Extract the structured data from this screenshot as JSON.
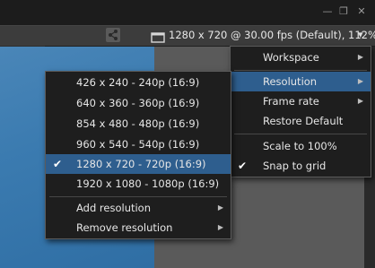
{
  "window": {
    "minimize": "—",
    "restore": "❐",
    "close": "✕"
  },
  "toolbar": {
    "status": "1280 x 720 @ 30.00 fps (Default), 112%",
    "share_icon": "share-icon",
    "screen_icon": "screen-icon",
    "dropdown": "▾"
  },
  "main_menu": {
    "items": [
      {
        "label": "Workspace",
        "submenu": true
      },
      {
        "label": "Resolution",
        "submenu": true,
        "highlighted": true
      },
      {
        "label": "Frame rate",
        "submenu": true
      },
      {
        "label": "Restore Default"
      },
      {
        "label": "Scale to 100%"
      },
      {
        "label": "Snap to grid",
        "checked": true
      }
    ],
    "arrow": "▶"
  },
  "resolution_menu": {
    "items": [
      {
        "label": "426 x 240 - 240p (16:9)"
      },
      {
        "label": "640 x 360 - 360p (16:9)"
      },
      {
        "label": "854 x 480 - 480p (16:9)"
      },
      {
        "label": "960 x 540 - 540p (16:9)"
      },
      {
        "label": "1280 x 720 - 720p (16:9)",
        "checked": true,
        "highlighted": true
      },
      {
        "label": "1920 x 1080 - 1080p (16:9)"
      },
      {
        "label": "Add resolution",
        "submenu": true
      },
      {
        "label": "Remove resolution",
        "submenu": true
      }
    ],
    "check": "✔"
  },
  "colors": {
    "highlight": "#2e5e8e",
    "video": "#3b7bb0",
    "menu_bg": "#1e1e1e"
  }
}
